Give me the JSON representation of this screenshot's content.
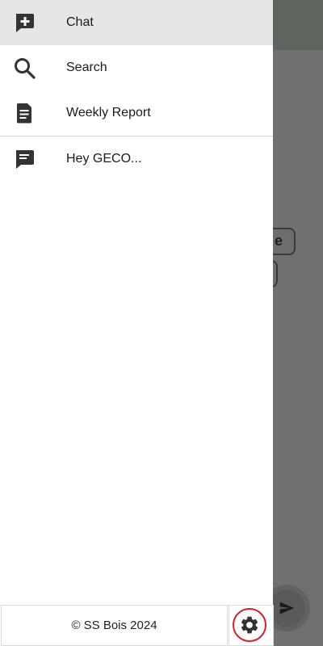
{
  "drawer": {
    "items": [
      {
        "label": "Chat",
        "icon": "add-chat-icon",
        "active": true
      },
      {
        "label": "Search",
        "icon": "search-icon",
        "active": false
      },
      {
        "label": "Weekly Report",
        "icon": "document-icon",
        "active": false
      }
    ],
    "conversations": [
      {
        "label": "Hey GECO...",
        "icon": "chat-bubble-icon"
      }
    ],
    "footer": {
      "copyright": "© SS Bois 2024",
      "settings_icon": "gear-icon"
    }
  },
  "background": {
    "chip_text": "e"
  },
  "colors": {
    "active_bg": "#e6e6e6",
    "icon": "#333333",
    "highlight_ring": "#d0202a",
    "scrim": "#707070"
  }
}
